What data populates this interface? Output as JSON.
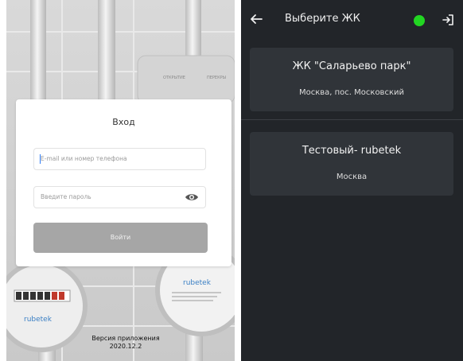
{
  "login": {
    "title": "Вход",
    "email_placeholder": "E-mail или номер телефона",
    "password_placeholder": "Введите пароль",
    "submit_label": "Войти",
    "version_label": "Версия приложения",
    "version_value": "2020.12.2"
  },
  "background": {
    "meter_brand": "rubetek",
    "cabinet_label_1": "ОТКРЫТИЕ",
    "cabinet_label_2": "ПЕРЕКРЫ"
  },
  "select_screen": {
    "title": "Выберите ЖК",
    "status_color": "#22d622",
    "items": [
      {
        "name": "ЖК \"Саларьево парк\"",
        "location": "Москва, пос. Московский"
      },
      {
        "name": "Тестовый-  rubetek",
        "location": "Москва"
      }
    ]
  },
  "colors": {
    "dark_bg": "#222529",
    "card_bg": "#303439",
    "button_disabled": "#a6a6a6"
  },
  "icons": {
    "back": "arrow-left-icon",
    "logout": "logout-icon",
    "eye": "eye-icon"
  }
}
